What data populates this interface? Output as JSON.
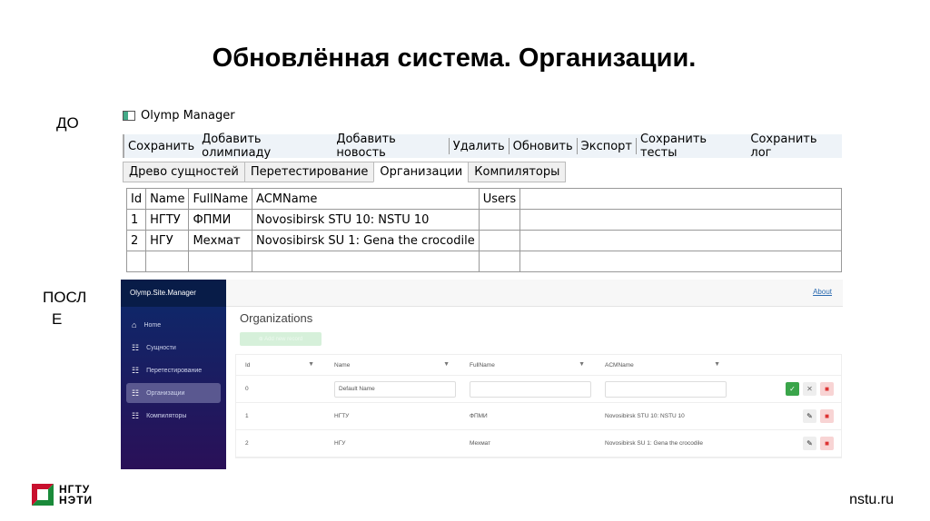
{
  "slide": {
    "title": "Обновлённая система. Организации.",
    "before_label": "ДО",
    "after_label_1": "ПОСЛ",
    "after_label_2": "Е",
    "site": "nstu.ru",
    "logo": {
      "line1": "НГТУ",
      "line2": "НЭТИ"
    }
  },
  "old_app": {
    "window_title": "Olymp Manager",
    "toolbar": [
      "Сохранить",
      "Добавить олимпиаду",
      "Добавить новость",
      "Удалить",
      "Обновить",
      "Экспорт",
      "Сохранить тесты",
      "Сохранить лог"
    ],
    "tabs": [
      "Древо сущностей",
      "Перетестирование",
      "Организации",
      "Компиляторы"
    ],
    "columns": [
      "Id",
      "Name",
      "FullName",
      "ACMName",
      "Users"
    ],
    "rows": [
      [
        "1",
        "НГТУ",
        "ФПМИ",
        "Novosibirsk STU 10: NSTU 10",
        ""
      ],
      [
        "2",
        "НГУ",
        "Мехмат",
        "Novosibirsk SU 1: Gena the crocodile",
        ""
      ]
    ]
  },
  "new_app": {
    "brand": "Olymp.Site.Manager",
    "about": "About",
    "nav": [
      "Home",
      "Сущности",
      "Перетестирование",
      "Организации",
      "Компиляторы"
    ],
    "heading": "Organizations",
    "add_button": "⊕ Add new record",
    "columns": [
      "Id",
      "Name",
      "FullName",
      "ACMName"
    ],
    "new_row": {
      "id": "0",
      "name": "Default Name",
      "fullname": "",
      "acmname": ""
    },
    "rows": [
      [
        "1",
        "НГТУ",
        "ФПМИ",
        "Novosibirsk STU 10: NSTU 10"
      ],
      [
        "2",
        "НГУ",
        "Мехмат",
        "Novosibirsk SU 1: Gena the crocodile"
      ]
    ]
  },
  "colors": {
    "sidebar_top": "#0b2a6b",
    "sidebar_bottom": "#2a1058",
    "success": "#3aa54a",
    "danger": "#d33333"
  }
}
